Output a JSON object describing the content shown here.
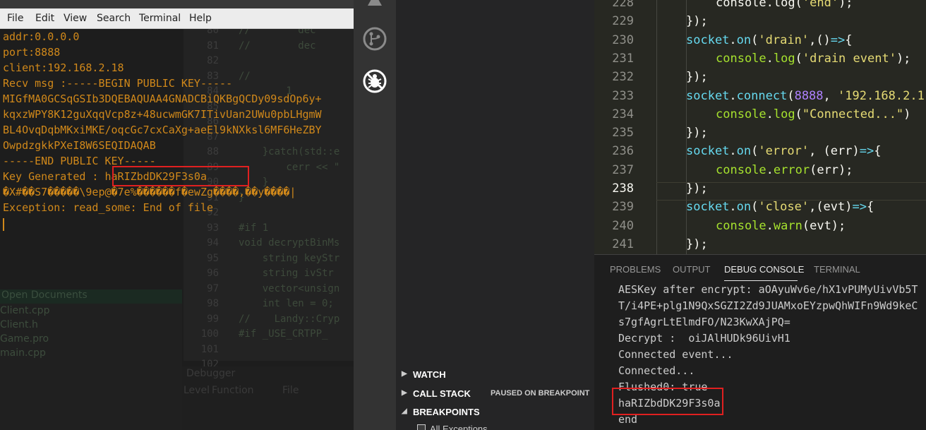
{
  "terminal": {
    "menu": [
      "File",
      "Edit",
      "View",
      "Search",
      "Terminal",
      "Help"
    ],
    "lines": [
      "addr:0.0.0.0",
      "port:8888",
      "client:192.168.2.18",
      "Recv msg :-----BEGIN PUBLIC KEY-----",
      "MIGfMA0GCSqGSIb3DQEBAQUAA4GNADCBiQKBgQCDy09sdOp6y+",
      "kqxzWPY8K12guXqqVcp8z+48ucwmGK7ITivUan2UWu0pbLHgmW",
      "BL4OvqDqbMKxiMKE/oqcGc7cxCaXg+aeEl9kNXksl6MF6HeZBY",
      "OwpdzgkkPXeI8W6SEQIDAQAB",
      "-----END PUBLIC KEY-----",
      "Key Generated : haRIZbdDK29F3s0a",
      "�X#��S7�����\\9ep@�7e%������f�ewZg����,��y����|",
      "Exception: read_some: End of file"
    ]
  },
  "qt_creator": {
    "code_lines": [
      {
        "n": "80",
        "c": "//        dec"
      },
      {
        "n": "81",
        "c": "//        dec"
      },
      {
        "n": "82",
        "c": ""
      },
      {
        "n": "83",
        "c": "//"
      },
      {
        "n": "84",
        "c": "        1"
      },
      {
        "n": "85",
        "c": ""
      },
      {
        "n": "86",
        "c": ""
      },
      {
        "n": "87",
        "c": ""
      },
      {
        "n": "88",
        "c": "    }catch(std::e"
      },
      {
        "n": "89",
        "c": "        cerr << \""
      },
      {
        "n": "90",
        "c": "    }"
      },
      {
        "n": "91",
        "c": "}"
      },
      {
        "n": "92",
        "c": ""
      },
      {
        "n": "93",
        "c": "#if 1"
      },
      {
        "n": "94",
        "c": "void decryptBinMs"
      },
      {
        "n": "95",
        "c": "    string keyStr"
      },
      {
        "n": "96",
        "c": "    string ivStr"
      },
      {
        "n": "97",
        "c": "    vector<unsign"
      },
      {
        "n": "98",
        "c": "    int len = 0;"
      },
      {
        "n": "99",
        "c": "//    Landy::Cryp"
      },
      {
        "n": "100",
        "c": "#if _USE_CRTPP_"
      },
      {
        "n": "101",
        "c": ""
      },
      {
        "n": "102",
        "c": ""
      }
    ],
    "open_documents_title": "Open Documents",
    "open_documents": [
      "Client.cpp",
      "Client.h",
      "Game.pro",
      "main.cpp"
    ],
    "debugger_title": "Debugger",
    "debugger_cols": [
      "Level",
      "Function",
      "File"
    ]
  },
  "vscode_debug": {
    "sections": [
      {
        "label": "WATCH",
        "arrow": "▶"
      },
      {
        "label": "CALL STACK",
        "arrow": "▶",
        "right": "PAUSED ON BREAKPOINT"
      },
      {
        "label": "BREAKPOINTS",
        "arrow": "◢"
      }
    ],
    "all_exceptions": "All Exceptions"
  },
  "editor": {
    "current_line": "238",
    "lines": [
      {
        "n": "228",
        "segs": [
          {
            "t": "console",
            "k": ""
          },
          {
            "t": ".",
            "k": ""
          },
          {
            "t": "log",
            "k": ""
          },
          {
            "t": "(",
            "k": ""
          },
          {
            "t": "'end'",
            "k": "str"
          },
          {
            "t": ");",
            "k": ""
          }
        ]
      },
      {
        "n": "229",
        "segs": [
          {
            "t": "});",
            "k": ""
          }
        ]
      },
      {
        "n": "230",
        "segs": [
          {
            "t": "socket",
            "k": "kw"
          },
          {
            "t": ".",
            "k": ""
          },
          {
            "t": "on",
            "k": "kw"
          },
          {
            "t": "(",
            "k": ""
          },
          {
            "t": "'drain'",
            "k": "str"
          },
          {
            "t": ",",
            "k": ""
          },
          {
            "t": "()",
            "k": ""
          },
          {
            "t": "=>",
            "k": "kw"
          },
          {
            "t": "{",
            "k": ""
          }
        ]
      },
      {
        "n": "231",
        "segs": [
          {
            "t": "console",
            "k": "fn"
          },
          {
            "t": ".",
            "k": ""
          },
          {
            "t": "log",
            "k": "fn"
          },
          {
            "t": "(",
            "k": ""
          },
          {
            "t": "'drain event'",
            "k": "str"
          },
          {
            "t": ");",
            "k": ""
          }
        ]
      },
      {
        "n": "232",
        "segs": [
          {
            "t": "});",
            "k": ""
          }
        ]
      },
      {
        "n": "233",
        "segs": [
          {
            "t": "socket",
            "k": "kw"
          },
          {
            "t": ".",
            "k": ""
          },
          {
            "t": "connect",
            "k": "kw"
          },
          {
            "t": "(",
            "k": ""
          },
          {
            "t": "8888",
            "k": "num"
          },
          {
            "t": ", ",
            "k": ""
          },
          {
            "t": "'192.168.2.1",
            "k": "str"
          }
        ]
      },
      {
        "n": "234",
        "segs": [
          {
            "t": "console",
            "k": "fn"
          },
          {
            "t": ".",
            "k": ""
          },
          {
            "t": "log",
            "k": "fn"
          },
          {
            "t": "(",
            "k": ""
          },
          {
            "t": "\"Connected...\"",
            "k": "str"
          },
          {
            "t": ")",
            "k": ""
          }
        ]
      },
      {
        "n": "235",
        "segs": [
          {
            "t": "});",
            "k": ""
          }
        ]
      },
      {
        "n": "236",
        "segs": [
          {
            "t": "socket",
            "k": "kw"
          },
          {
            "t": ".",
            "k": ""
          },
          {
            "t": "on",
            "k": "kw"
          },
          {
            "t": "(",
            "k": ""
          },
          {
            "t": "'error'",
            "k": "str"
          },
          {
            "t": ", ",
            "k": ""
          },
          {
            "t": "(err)",
            "k": ""
          },
          {
            "t": "=>",
            "k": "kw"
          },
          {
            "t": "{",
            "k": ""
          }
        ]
      },
      {
        "n": "237",
        "segs": [
          {
            "t": "console",
            "k": "fn"
          },
          {
            "t": ".",
            "k": ""
          },
          {
            "t": "error",
            "k": "fn"
          },
          {
            "t": "(err);",
            "k": ""
          }
        ]
      },
      {
        "n": "238",
        "segs": [
          {
            "t": "});",
            "k": ""
          }
        ]
      },
      {
        "n": "239",
        "segs": [
          {
            "t": "socket",
            "k": "kw"
          },
          {
            "t": ".",
            "k": ""
          },
          {
            "t": "on",
            "k": "kw"
          },
          {
            "t": "(",
            "k": ""
          },
          {
            "t": "'close'",
            "k": "str"
          },
          {
            "t": ",",
            "k": ""
          },
          {
            "t": "(evt)",
            "k": ""
          },
          {
            "t": "=>",
            "k": "kw"
          },
          {
            "t": "{",
            "k": ""
          }
        ]
      },
      {
        "n": "240",
        "segs": [
          {
            "t": "console",
            "k": "fn"
          },
          {
            "t": ".",
            "k": ""
          },
          {
            "t": "warn",
            "k": "fn"
          },
          {
            "t": "(evt);",
            "k": ""
          }
        ]
      },
      {
        "n": "241",
        "segs": [
          {
            "t": "});",
            "k": ""
          }
        ]
      }
    ]
  },
  "panel": {
    "tabs": [
      "PROBLEMS",
      "OUTPUT",
      "DEBUG CONSOLE",
      "TERMINAL"
    ],
    "active_tab": "DEBUG CONSOLE",
    "console_lines": [
      "AESKey after encrypt: aOAyuWv6e/hX1vPUMyUivVb5T",
      "T/i4PE+plg1N9QxSGZI2Zd9JUAMxoEYzpwQhWIFn9Wd9keC",
      "s7gfAgrLtElmdFO/N23KwXAjPQ=",
      "Decrypt :  oiJAlHUDk96UivH1",
      "Connected event...",
      "Connected...",
      "Flushed0: true",
      "haRIZbdDK29F3s0a",
      "end"
    ]
  },
  "colors": {
    "terminal_text": "#d0881a",
    "highlight_box": "#e02020",
    "editor_bg": "#272822"
  }
}
